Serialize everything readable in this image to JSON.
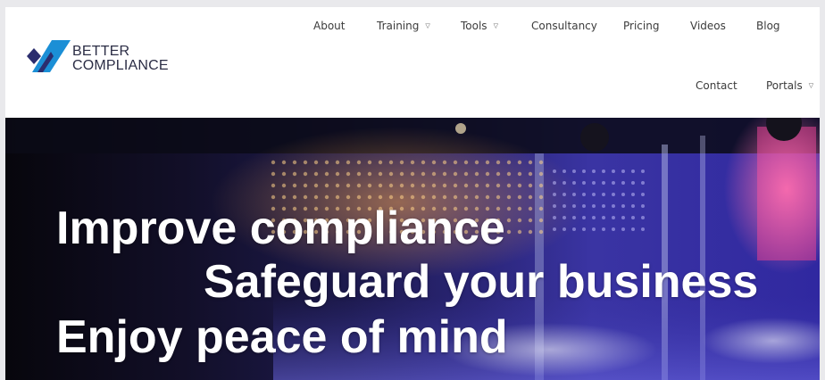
{
  "brand": {
    "name_line1": "BETTER",
    "name_line2": "COMPLIANCE",
    "colors": {
      "navy": "#2b2d6e",
      "blue": "#1b8fd6"
    }
  },
  "nav": {
    "about": "About",
    "training": "Training",
    "tools": "Tools",
    "consultancy": "Consultancy",
    "pricing": "Pricing",
    "videos": "Videos",
    "blog": "Blog",
    "contact": "Contact",
    "portals": "Portals",
    "dropdown_icon": "chevron-down-icon"
  },
  "hero": {
    "line1": "Improve compliance",
    "line2": "Safeguard your business",
    "line3": "Enjoy peace of mind"
  }
}
